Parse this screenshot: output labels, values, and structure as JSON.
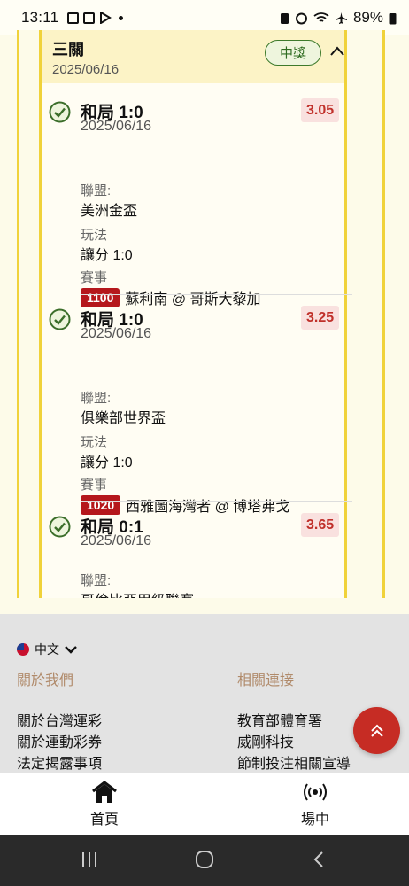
{
  "status_bar": {
    "time": "13:11",
    "battery": "89%"
  },
  "group": {
    "title": "三關",
    "date": "2025/06/16",
    "badge": "中獎"
  },
  "labels": {
    "league": "聯盟:",
    "play": "玩法",
    "event": "賽事"
  },
  "bets": [
    {
      "pick": "和局 1:0",
      "date": "2025/06/16",
      "odds": "3.05",
      "league": "美洲金盃",
      "play": "讓分 1:0",
      "code": "1100",
      "event": "蘇利南 @ 哥斯大黎加"
    },
    {
      "pick": "和局 1:0",
      "date": "2025/06/16",
      "odds": "3.25",
      "league": "俱樂部世界盃",
      "play": "讓分 1:0",
      "code": "1020",
      "event": "西雅圖海灣者 @ 博塔弗戈"
    },
    {
      "pick": "和局 0:1",
      "date": "2025/06/16",
      "odds": "3.65",
      "league": "哥倫比亞甲級聯賽"
    }
  ],
  "footer": {
    "language": "中文",
    "col1": {
      "heading": "關於我們",
      "links": [
        "關於台灣運彩",
        "關於運動彩券",
        "法定揭露事項"
      ]
    },
    "col2": {
      "heading": "相關連接",
      "links": [
        "教育部體育署",
        "威剛科技",
        "節制投注相關宣導"
      ]
    }
  },
  "bottom_nav": {
    "home": "首頁",
    "live": "場中"
  },
  "colors": {
    "accent": "#f0d23a",
    "win": "#2e6b20",
    "odds": "#c0302a",
    "code_bg": "#b5171c",
    "fab": "#c62c24"
  }
}
